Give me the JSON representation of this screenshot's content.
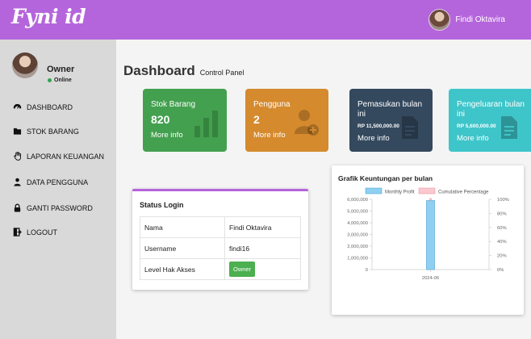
{
  "app": {
    "brand": "Fyni id"
  },
  "topbar": {
    "user_name": "Findi Oktavira"
  },
  "sidebar": {
    "role": "Owner",
    "status": "Online",
    "items": [
      {
        "label": "DASHBOARD",
        "icon": "dashboard-icon"
      },
      {
        "label": "STOK BARANG",
        "icon": "folder-icon"
      },
      {
        "label": "LAPORAN KEUANGAN",
        "icon": "hand-icon"
      },
      {
        "label": "DATA PENGGUNA",
        "icon": "user-icon"
      },
      {
        "label": "GANTI PASSWORD",
        "icon": "lock-icon"
      },
      {
        "label": "LOGOUT",
        "icon": "logout-icon"
      }
    ]
  },
  "page": {
    "title": "Dashboard",
    "subtitle": "Control Panel"
  },
  "cards": [
    {
      "label": "Stok Barang",
      "value": "820",
      "more": "More info",
      "icon": "bar-chart-icon",
      "color": "#3f9e4d"
    },
    {
      "label": "Pengguna",
      "value": "2",
      "more": "More info",
      "icon": "add-user-icon",
      "color": "#d58a2e"
    },
    {
      "label": "Pemasukan bulan ini",
      "value": "RP 11,500,000.00",
      "more": "More info",
      "icon": "document-icon",
      "color": "#35495e"
    },
    {
      "label": "Pengeluaran bulan ini",
      "value": "RP 5,600,000.00",
      "more": "More info",
      "icon": "document-icon",
      "color": "#3fc4c9"
    }
  ],
  "status_login": {
    "title": "Status Login",
    "rows": [
      {
        "key": "Nama",
        "value": "Findi Oktavira"
      },
      {
        "key": "Username",
        "value": "findi16"
      },
      {
        "key": "Level Hak Akses",
        "value": "Owner"
      }
    ]
  },
  "chart_panel": {
    "title": "Grafik Keuntungan per bulan"
  },
  "chart_data": {
    "type": "bar",
    "categories": [
      "2024-06"
    ],
    "series": [
      {
        "name": "Monthly Profit",
        "values": [
          5900000
        ],
        "color": "#8ecff2"
      },
      {
        "name": "Cumulative Percentage",
        "values": [
          100
        ],
        "color": "#f9c9cf",
        "axis": "right"
      }
    ],
    "ylim": [
      0,
      6000000
    ],
    "y_ticks": [
      "0",
      "1,000,000",
      "2,000,000",
      "3,000,000",
      "4,000,000",
      "5,000,000",
      "6,000,000"
    ],
    "y2lim": [
      0,
      100
    ],
    "y2_ticks": [
      "0%",
      "20%",
      "40%",
      "60%",
      "80%",
      "100%"
    ],
    "legend": "top",
    "grid": false
  }
}
